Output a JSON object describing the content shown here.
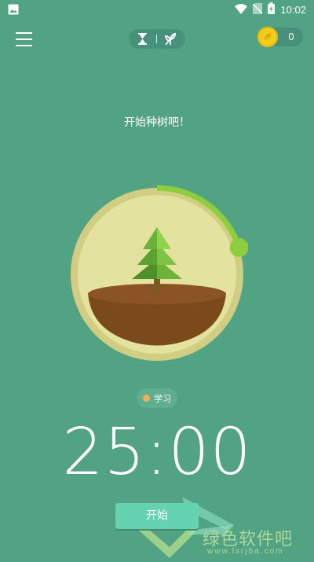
{
  "status_bar": {
    "time": "10:02",
    "icons": [
      "image-icon",
      "wifi-icon",
      "no-sim-icon",
      "battery-charging-icon"
    ]
  },
  "header": {
    "menu_icon": "hamburger-menu-icon",
    "mode_icons": [
      "hourglass-icon",
      "no-sapling-icon"
    ],
    "coins": "0"
  },
  "main": {
    "prompt": "开始种树吧！",
    "tag_label": "学习",
    "tag_color": "#EDB05C",
    "timer": "25:00",
    "timer_progress": 0.2,
    "start_label": "开始"
  },
  "watermark": {
    "text": "绿色软件吧",
    "url": "www.lsrjba.com"
  },
  "colors": {
    "background": "#52A383",
    "ring": "#D1CD82",
    "progress": "#8DCD3E",
    "soil": "#7A4A1B",
    "button": "#65D3B0"
  }
}
